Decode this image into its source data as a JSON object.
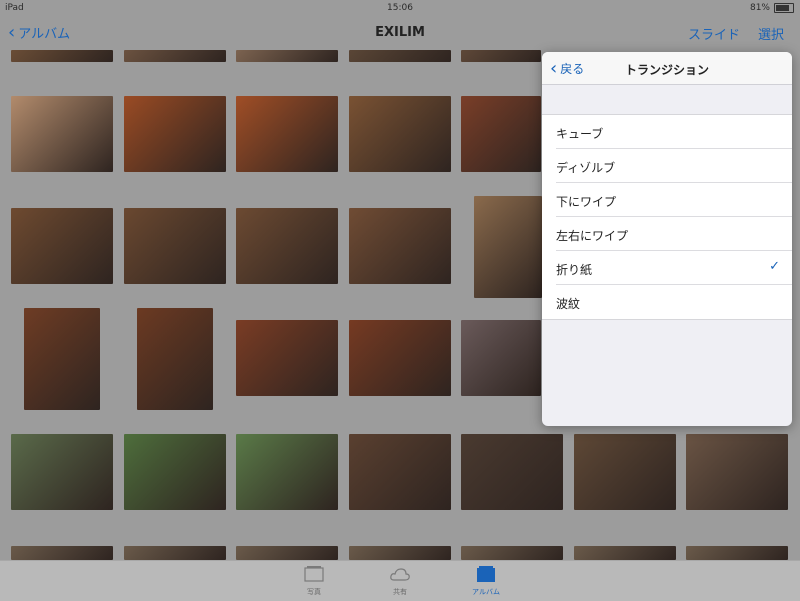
{
  "status": {
    "device": "iPad",
    "time": "15:06",
    "battery": "81%",
    "battery_level": 0.81
  },
  "nav": {
    "back_label": "アルバム",
    "title": "EXILIM",
    "slide_label": "スライド",
    "select_label": "選択"
  },
  "popover": {
    "back_label": "戻る",
    "title": "トランジション",
    "items": [
      {
        "label": "キューブ",
        "checked": false
      },
      {
        "label": "ディゾルブ",
        "checked": false
      },
      {
        "label": "下にワイプ",
        "checked": false
      },
      {
        "label": "左右にワイプ",
        "checked": false
      },
      {
        "label": "折り紙",
        "checked": true
      },
      {
        "label": "波紋",
        "checked": false
      }
    ]
  },
  "tabs": [
    {
      "label": "写真",
      "active": false
    },
    {
      "label": "共有",
      "active": false
    },
    {
      "label": "アルバム",
      "active": true
    }
  ],
  "colors": {
    "accent": "#1a63b8"
  }
}
